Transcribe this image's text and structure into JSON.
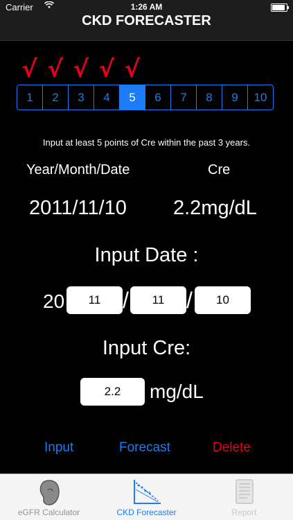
{
  "status_bar": {
    "carrier": "Carrier",
    "time": "1:26 AM"
  },
  "nav": {
    "title": "CKD FORECASTER"
  },
  "checkmark": "√",
  "points": {
    "segments": [
      "1",
      "2",
      "3",
      "4",
      "5",
      "6",
      "7",
      "8",
      "9",
      "10"
    ],
    "selected_index": 4,
    "checked_count": 5
  },
  "instruction": "Input at least 5 points of Cre within the past 3 years.",
  "display": {
    "date_header": "Year/Month/Date",
    "cre_header": "Cre",
    "date_value": "2011/11/10",
    "cre_value": "2.2mg/dL"
  },
  "input_date": {
    "title": "Input Date :",
    "year_prefix": "20",
    "year": "11",
    "separator": "/",
    "month": "11",
    "day": "10"
  },
  "input_cre": {
    "title": "Input Cre:",
    "value": "2.2",
    "unit": "mg/dL"
  },
  "actions": {
    "input": "Input",
    "forecast": "Forecast",
    "delete": "Delete"
  },
  "tabs": [
    {
      "label": "eGFR Calculator",
      "icon": "kidney-icon"
    },
    {
      "label": "CKD Forecaster",
      "icon": "forecast-chart-icon"
    },
    {
      "label": "Report",
      "icon": "report-icon"
    }
  ],
  "colors": {
    "accent": "#1b7cf5",
    "check": "#e8001c",
    "delete": "#e8001c"
  }
}
